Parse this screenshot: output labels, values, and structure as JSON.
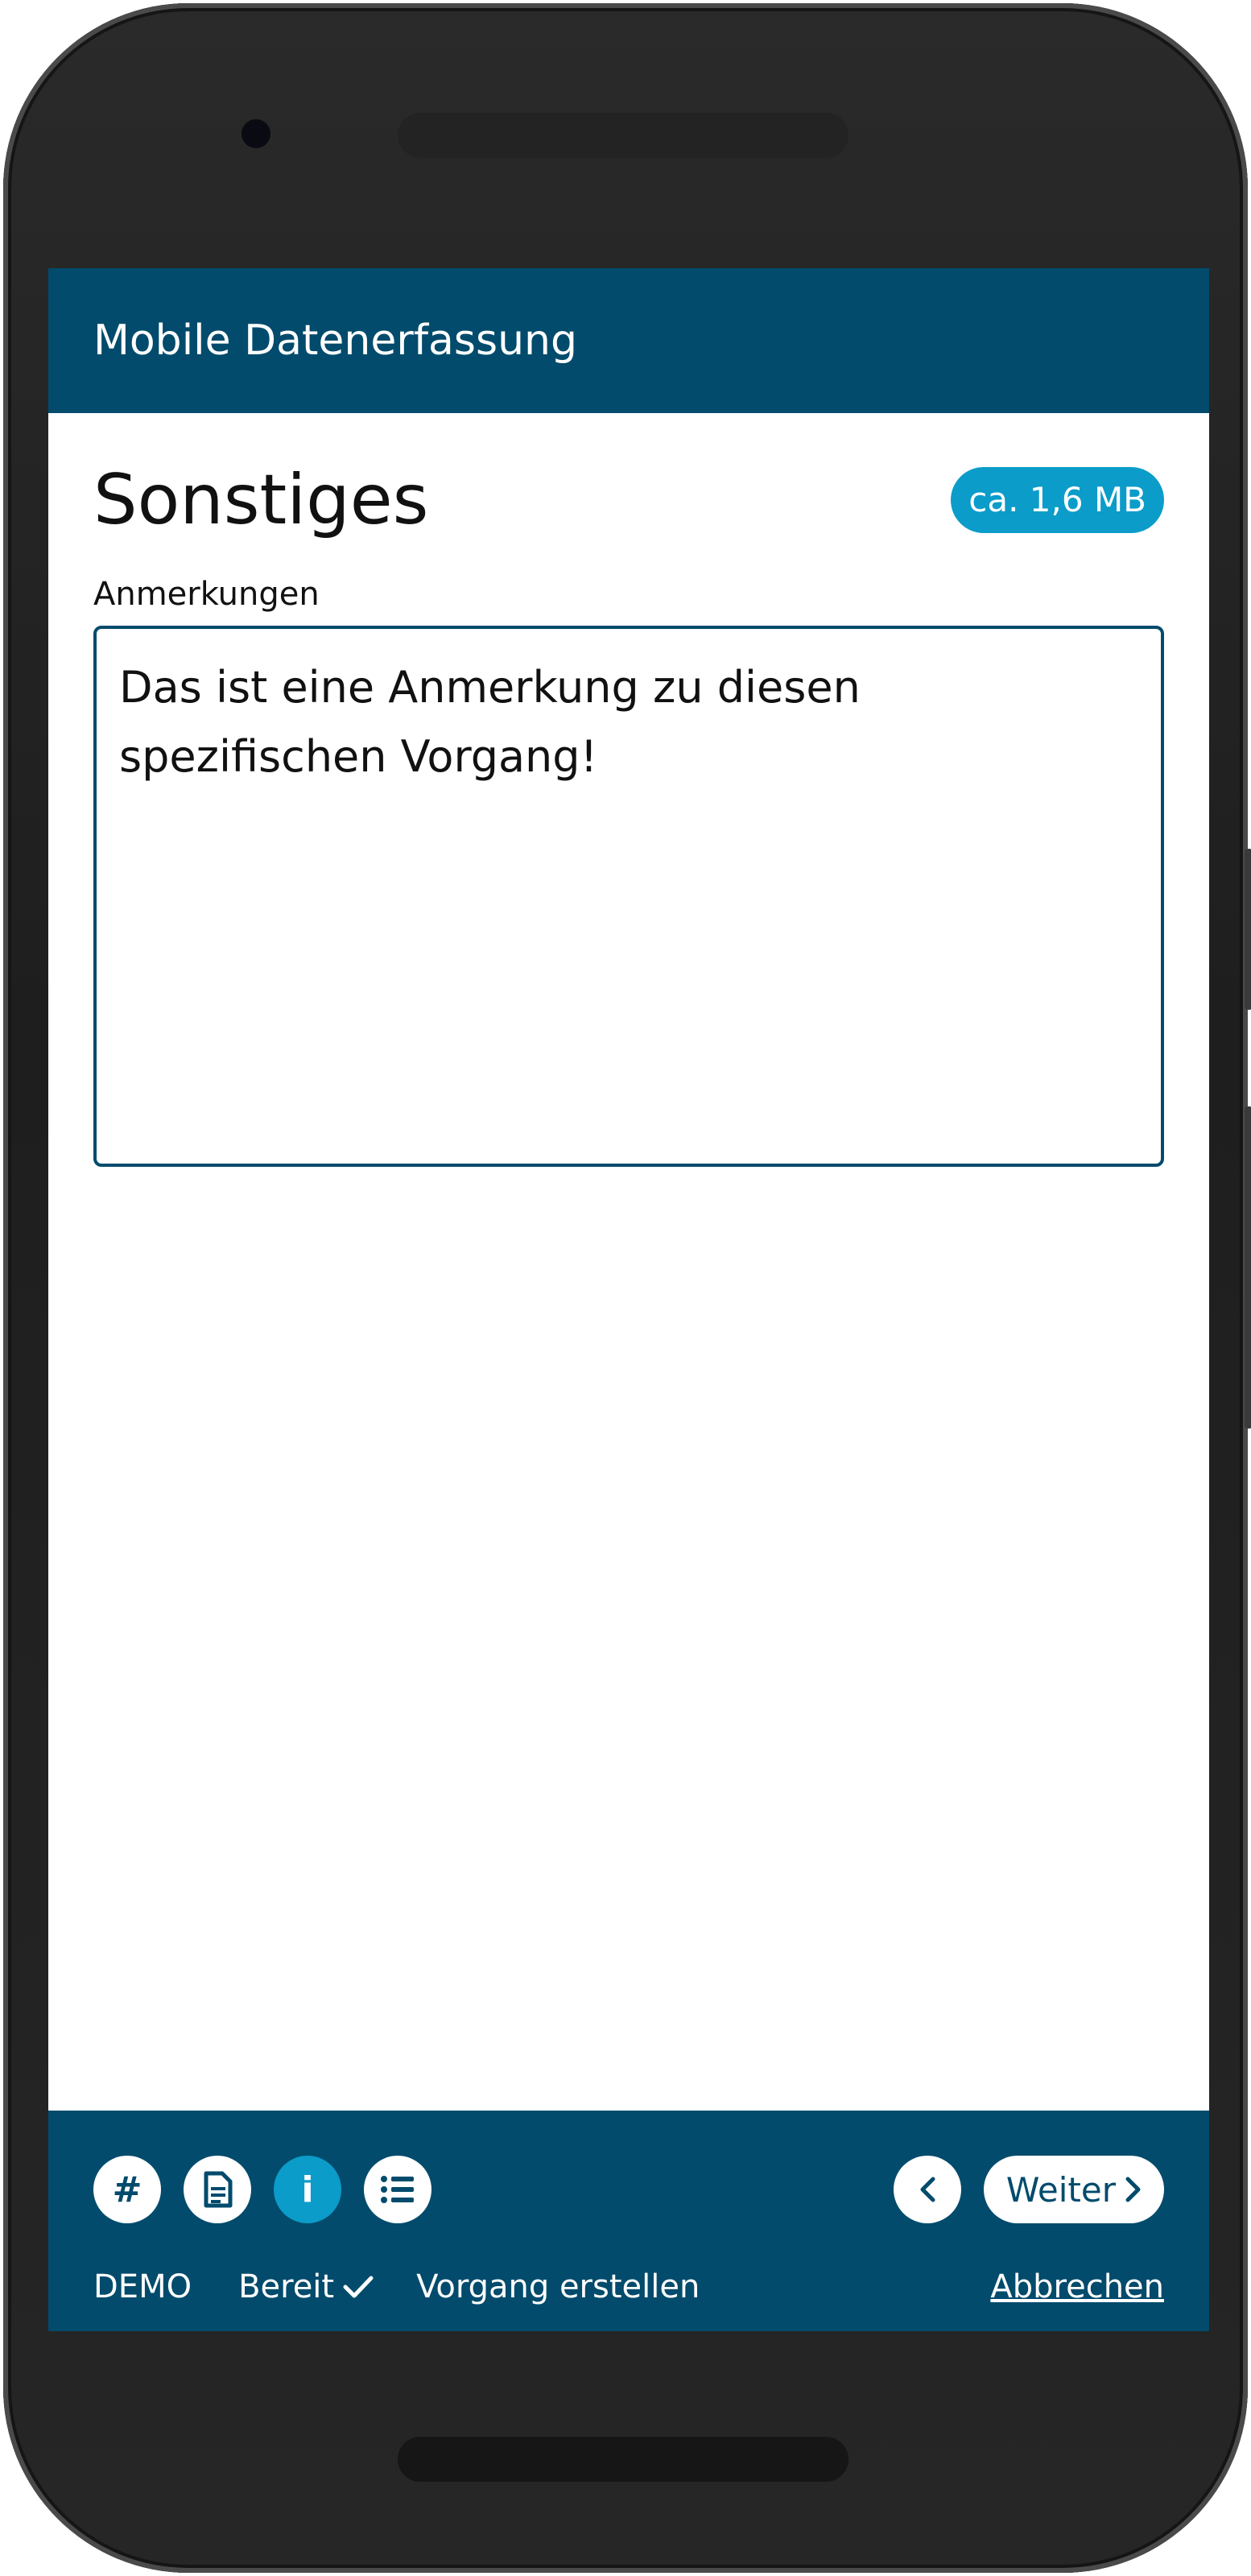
{
  "app": {
    "title": "Mobile Datenerfassung"
  },
  "page": {
    "title": "Sonstiges",
    "size_badge": "ca. 1,6 MB"
  },
  "form": {
    "remarks_label": "Anmerkungen",
    "remarks_value": "Das ist eine Anmerkung zu diesen spezifischen Vorgang!"
  },
  "toolbar": {
    "icons": [
      "hash-icon",
      "document-icon",
      "info-icon",
      "list-icon"
    ],
    "active_icon": "info-icon",
    "hash_glyph": "#",
    "info_glyph": "i",
    "next_label": "Weiter"
  },
  "status": {
    "mode": "DEMO",
    "state": "Bereit",
    "action": "Vorgang erstellen",
    "cancel_label": "Abbrechen"
  },
  "colors": {
    "primary": "#024b6c",
    "accent": "#0b9cc9",
    "background": "#ffffff"
  }
}
